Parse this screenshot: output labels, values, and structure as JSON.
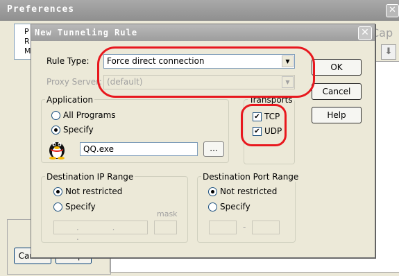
{
  "background_window": {
    "title": "Preferences",
    "close_glyph": "✕",
    "tree_items": [
      "P",
      "R",
      "M"
    ],
    "right_text": "Cap",
    "arrow_glyph": "⬇",
    "cancel_label": "Cancel",
    "help_label": "Help"
  },
  "dialog": {
    "title": "New Tunneling Rule",
    "close_glyph": "✕",
    "rule_type_label": "Rule Type:",
    "rule_type_value": "Force direct connection",
    "proxy_server_label": "Proxy Server:",
    "proxy_server_value": "(default)",
    "combo_arrow": "▼",
    "ok_label": "OK",
    "cancel_label": "Cancel",
    "help_label": "Help",
    "application": {
      "title": "Application",
      "all_programs_label": "All Programs",
      "specify_label": "Specify",
      "program_value": "QQ.exe",
      "browse_label": "..."
    },
    "transports": {
      "title": "Transports",
      "tcp_label": "TCP",
      "udp_label": "UDP",
      "check_glyph": "✔"
    },
    "dest_ip": {
      "title": "Destination IP Range",
      "not_restricted_label": "Not restricted",
      "specify_label": "Specify",
      "mask_label": "mask",
      "ip_dots": ". . ."
    },
    "dest_port": {
      "title": "Destination Port Range",
      "not_restricted_label": "Not restricted",
      "specify_label": "Specify",
      "dash": "-"
    }
  }
}
